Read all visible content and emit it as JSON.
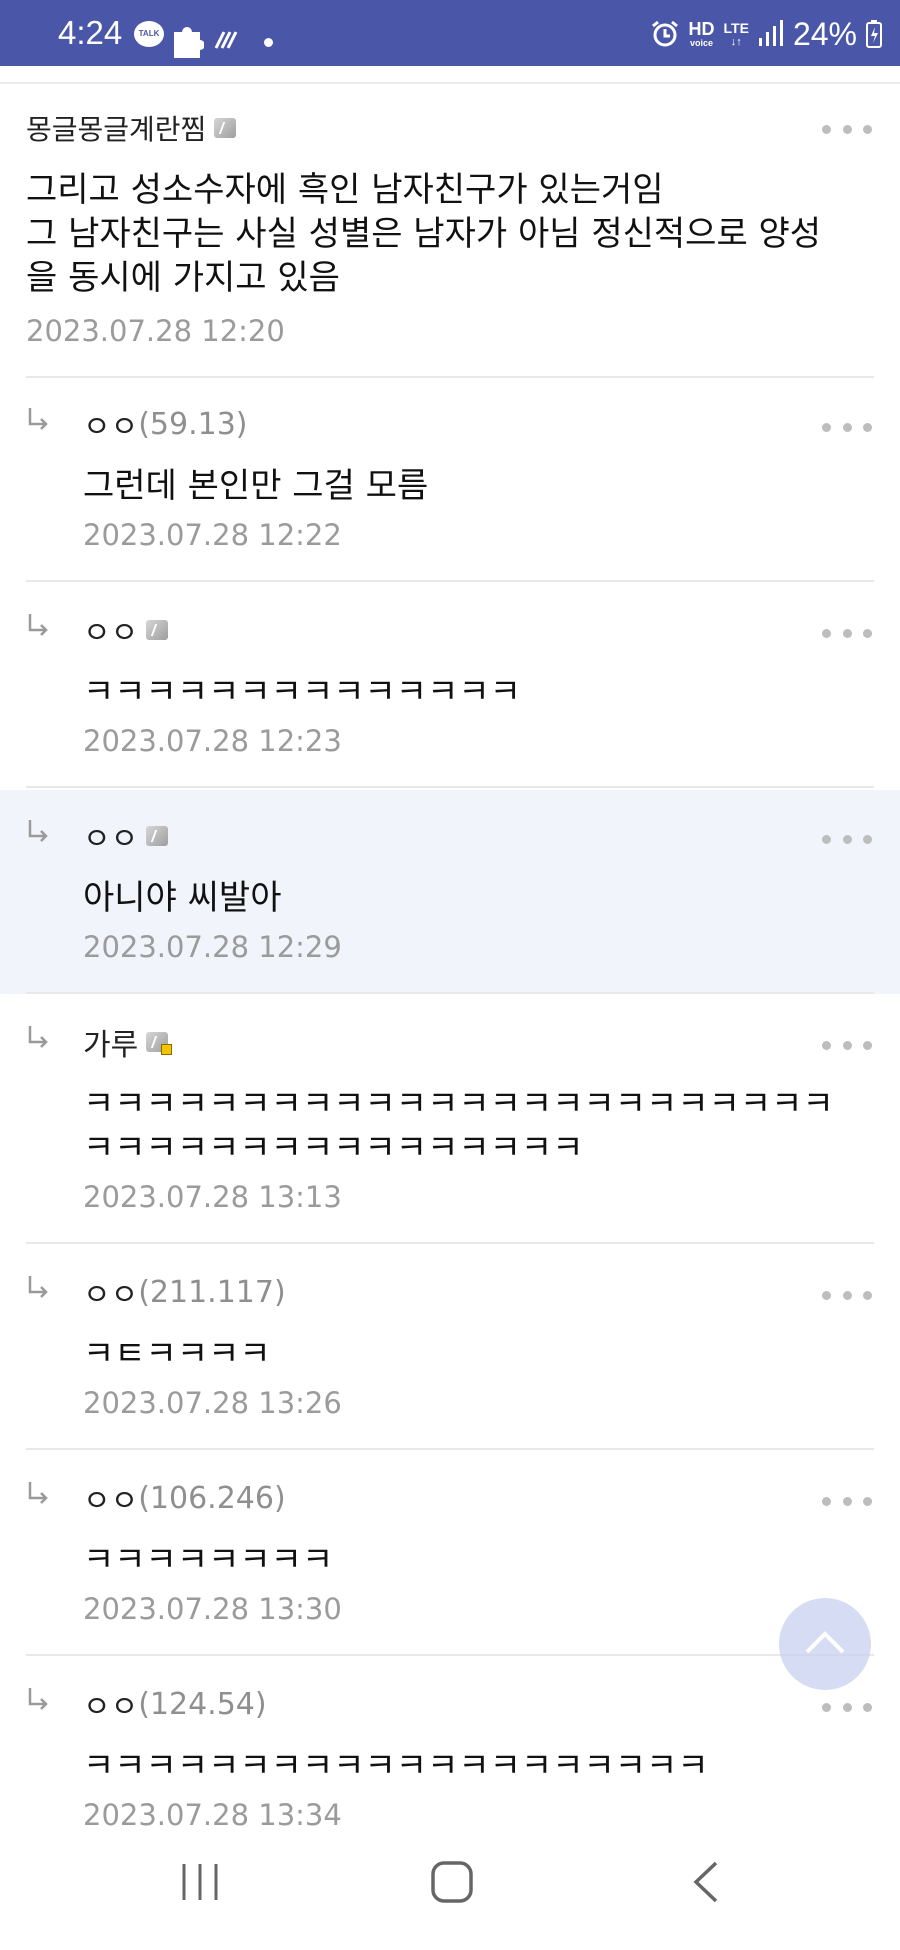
{
  "status_bar": {
    "time": "4:24",
    "talk_badge": "TALK",
    "hd_label": "HD",
    "voice_label": "voice",
    "lte_label": "LTE",
    "battery": "24%"
  },
  "post": {
    "author": "몽글몽글계란찜",
    "lines": [
      "그리고 성소수자에 흑인 남자친구가 있는거임",
      "그 남자친구는 사실 성별은 남자가 아님 정신적으로 양성",
      "을 동시에 가지고 있음"
    ],
    "date": "2023.07.28 12:20"
  },
  "replies": [
    {
      "author": "ㅇㅇ",
      "ip": "(59.13)",
      "badge": null,
      "lines": [
        "그런데 본인만 그걸 모름"
      ],
      "date": "2023.07.28 12:22",
      "highlight": false
    },
    {
      "author": "ㅇㅇ",
      "ip": "",
      "badge": "gray",
      "lines": [
        "ㅋㅋㅋㅋㅋㅋㅋㅋㅋㅋㅋㅋㅋㅋ"
      ],
      "date": "2023.07.28 12:23",
      "highlight": false
    },
    {
      "author": "ㅇㅇ",
      "ip": "",
      "badge": "gray",
      "lines": [
        "아니야 씨발아"
      ],
      "date": "2023.07.28 12:29",
      "highlight": true
    },
    {
      "author": "가루",
      "ip": "",
      "badge": "yellow",
      "lines": [
        "ㅋㅋㅋㅋㅋㅋㅋㅋㅋㅋㅋㅋㅋㅋㅋㅋㅋㅋㅋㅋㅋㅋㅋㅋ",
        "ㅋㅋㅋㅋㅋㅋㅋㅋㅋㅋㅋㅋㅋㅋㅋㅋ"
      ],
      "date": "2023.07.28 13:13",
      "highlight": false
    },
    {
      "author": "ㅇㅇ",
      "ip": "(211.117)",
      "badge": null,
      "lines": [
        "ㅋㅌㅋㅋㅋㅋ"
      ],
      "date": "2023.07.28 13:26",
      "highlight": false
    },
    {
      "author": "ㅇㅇ",
      "ip": "(106.246)",
      "badge": null,
      "lines": [
        "ㅋㅋㅋㅋㅋㅋㅋㅋ"
      ],
      "date": "2023.07.28 13:30",
      "highlight": false
    },
    {
      "author": "ㅇㅇ",
      "ip": "(124.54)",
      "badge": null,
      "lines": [
        "ㅋㅋㅋㅋㅋㅋㅋㅋㅋㅋㅋㅋㅋㅋㅋㅋㅋㅋㅋㅋ"
      ],
      "date": "2023.07.28 13:34",
      "highlight": false
    }
  ],
  "colors": {
    "status_bar": "#4a57a8",
    "highlight_bg": "#f2f4fc",
    "date_text": "#9b9b9b"
  },
  "icons": {
    "reply": "reply-arrow-icon",
    "more": "more-dots-icon",
    "scroll_top": "chevron-up-icon",
    "nav": [
      "recent-apps-icon",
      "home-icon",
      "back-icon"
    ]
  }
}
